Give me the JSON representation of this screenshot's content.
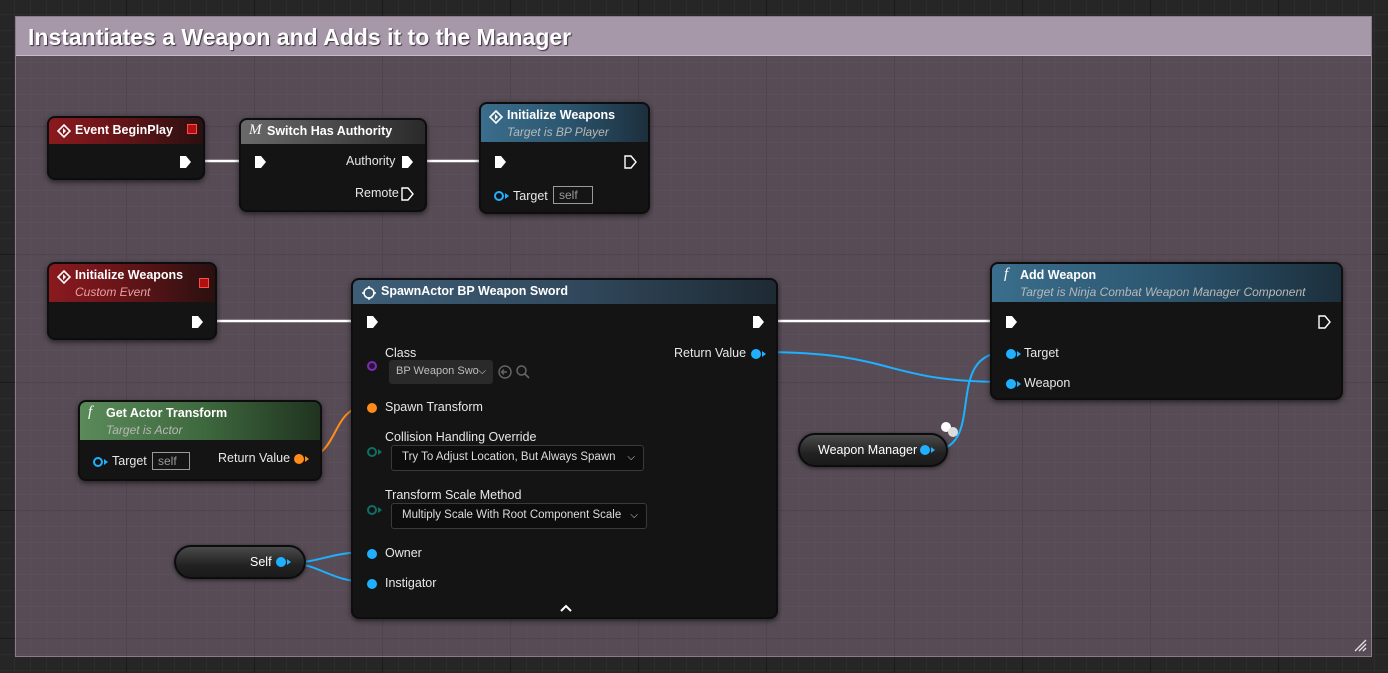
{
  "comment": {
    "title": "Instantiates a Weapon and Adds it to the Manager"
  },
  "nodes": {
    "event_begin_play": {
      "title": "Event BeginPlay"
    },
    "switch_authority": {
      "title": "Switch Has Authority",
      "authority_label": "Authority",
      "remote_label": "Remote"
    },
    "init_weapons_call": {
      "title": "Initialize Weapons",
      "subtitle": "Target is BP Player",
      "target_label": "Target",
      "target_value": "self"
    },
    "init_weapons_event": {
      "title": "Initialize Weapons",
      "subtitle": "Custom Event"
    },
    "spawn_actor": {
      "title": "SpawnActor BP Weapon Sword",
      "class_label": "Class",
      "class_value": "BP Weapon Swo",
      "return_label": "Return Value",
      "spawn_transform_label": "Spawn Transform",
      "collision_label": "Collision Handling Override",
      "collision_value": "Try To Adjust Location, But Always Spawn",
      "scale_label": "Transform Scale Method",
      "scale_value": "Multiply Scale With Root Component Scale",
      "owner_label": "Owner",
      "instigator_label": "Instigator"
    },
    "get_actor_transform": {
      "title": "Get Actor Transform",
      "subtitle": "Target is Actor",
      "target_label": "Target",
      "target_value": "self",
      "return_label": "Return Value"
    },
    "add_weapon": {
      "title": "Add Weapon",
      "subtitle": "Target is Ninja Combat Weapon Manager Component",
      "target_label": "Target",
      "weapon_label": "Weapon"
    },
    "weapon_manager_var": {
      "label": "Weapon Manager"
    },
    "self_var": {
      "label": "Self"
    }
  },
  "icons": {
    "event": "diamond-arrow-icon",
    "macro": "macro-m-icon",
    "function": "function-f-icon",
    "spawn": "spawn-actor-icon"
  },
  "colors": {
    "event_header": "#8a1a1f",
    "function_header": "#3a6e8c",
    "pure_header": "#5a8a5a",
    "object_pin": "#1fb0ff",
    "transform_pin": "#ff8c1a",
    "class_pin": "#7a2fb0",
    "enum_pin": "#0f6e66",
    "comment_header": "#a697a9"
  }
}
